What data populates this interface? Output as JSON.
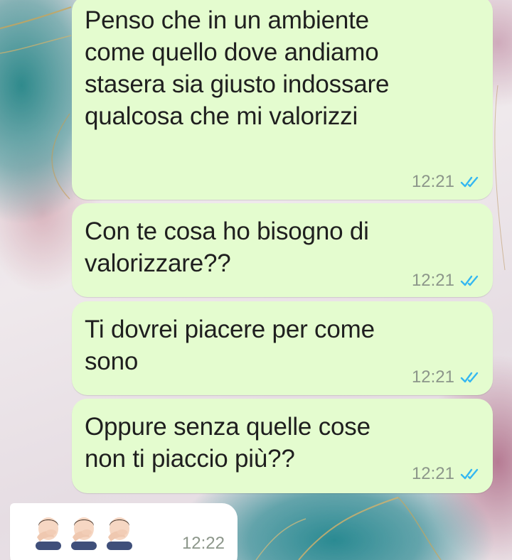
{
  "messages": [
    {
      "direction": "outgoing",
      "text": "Penso che in un ambiente come quello dove andiamo stasera sia giusto indossare qualcosa che mi valorizzi",
      "lines": [
        "Penso che in un ambiente",
        "come quello dove andiamo",
        "stasera sia giusto indossare",
        "qualcosa che mi valorizzi"
      ],
      "time": "12:21",
      "status": "read"
    },
    {
      "direction": "outgoing",
      "text": "Con te cosa ho bisogno di valorizzare??",
      "lines": [
        "Con te cosa ho bisogno di",
        "valorizzare??"
      ],
      "time": "12:21",
      "status": "read"
    },
    {
      "direction": "outgoing",
      "text": "Ti dovrei piacere per come sono",
      "lines": [
        "Ti dovrei piacere per come",
        "sono"
      ],
      "time": "12:21",
      "status": "read"
    },
    {
      "direction": "outgoing",
      "text": "Oppure senza quelle cose non ti piaccio più??",
      "lines": [
        "Oppure senza quelle cose",
        "non ti piaccio più??"
      ],
      "time": "12:21",
      "status": "read"
    },
    {
      "direction": "incoming",
      "emoji": [
        "man-facepalming-emoji",
        "man-facepalming-emoji",
        "man-facepalming-emoji"
      ],
      "time": "12:22"
    }
  ],
  "colors": {
    "outgoing_bubble": "#e4fccf",
    "incoming_bubble": "#ffffff",
    "read_ticks": "#34b7f1",
    "timestamp": "#8c968a"
  },
  "icons": {
    "read_receipt": "double-check-icon"
  }
}
